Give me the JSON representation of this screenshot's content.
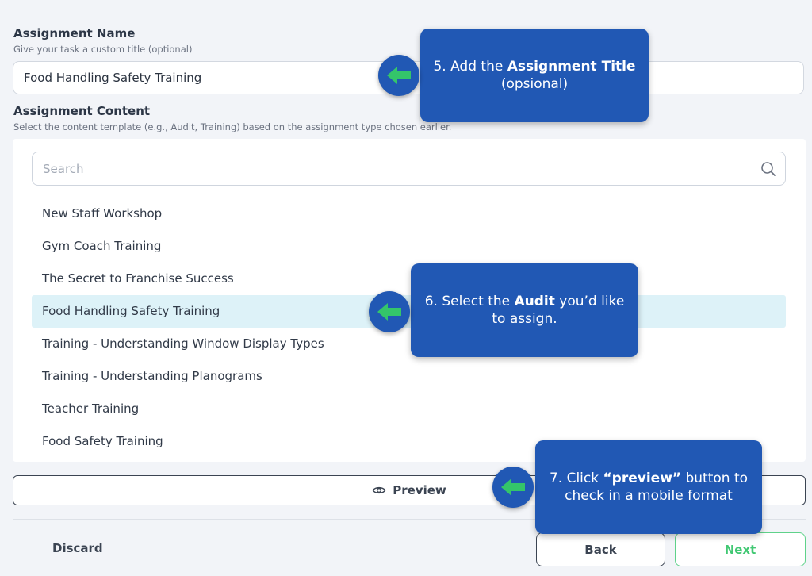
{
  "assignment_name": {
    "title": "Assignment Name",
    "hint": "Give your task a custom title (optional)",
    "value": "Food Handling Safety Training"
  },
  "assignment_content": {
    "title": "Assignment Content",
    "hint": "Select the content template (e.g., Audit, Training) based on the assignment type chosen earlier.",
    "search_placeholder": "Search",
    "items": [
      "New Staff Workshop",
      "Gym Coach Training",
      "The Secret to Franchise Success",
      "Food Handling Safety Training",
      "Training - Understanding Window Display Types",
      "Training - Understanding Planograms",
      "Teacher Training",
      "Food Safety Training"
    ],
    "selected_item": "Food Handling Safety Training"
  },
  "actions": {
    "preview_label": "Preview",
    "discard_label": "Discard",
    "back_label": "Back",
    "next_label": "Next"
  },
  "callouts": {
    "step5": {
      "prefix": "5. Add the ",
      "bold": "Assignment Title",
      "suffix": "(opsional)"
    },
    "step6": {
      "prefix": "6. Select the ",
      "bold": "Audit",
      "suffix": " you’d like to assign."
    },
    "step7": {
      "prefix": "7. Click ",
      "bold": "“preview”",
      "suffix": " button to check in a mobile format"
    }
  },
  "icons": {
    "search": "search-icon",
    "preview": "eye-icon",
    "pointer": "green-left-arrow-icon"
  },
  "colors": {
    "callout_bg": "#2158b4",
    "selected_row": "#ddf2f8",
    "next_accent": "#41c873",
    "pointer_arrow": "#34c56a"
  }
}
